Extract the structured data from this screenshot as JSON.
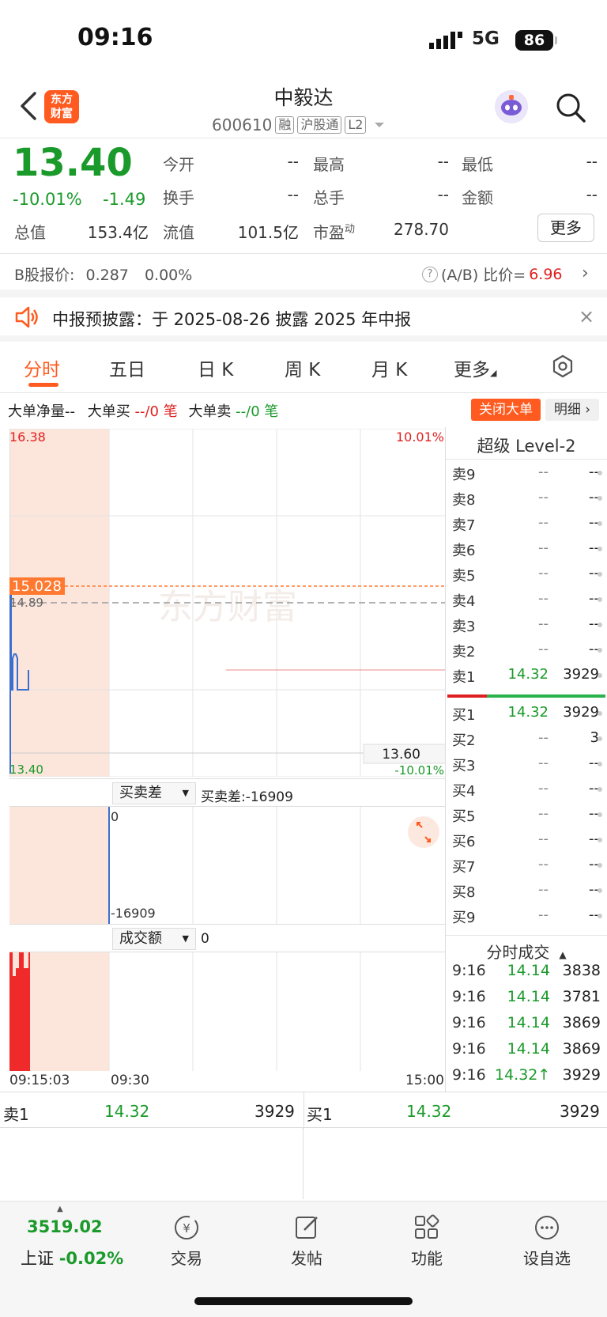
{
  "status": {
    "time": "09:16",
    "network": "5G",
    "battery": "86"
  },
  "header": {
    "logo": [
      "东方",
      "财富"
    ],
    "stock_name": "中毅达",
    "stock_code": "600610",
    "tags": [
      "融",
      "沪股通",
      "L2"
    ]
  },
  "quote": {
    "price": "13.40",
    "pct": "-10.01%",
    "change": "-1.49",
    "fields": [
      {
        "label": "今开",
        "value": "--"
      },
      {
        "label": "最高",
        "value": "--"
      },
      {
        "label": "最低",
        "value": "--"
      },
      {
        "label": "换手",
        "value": "--"
      },
      {
        "label": "总手",
        "value": "--"
      },
      {
        "label": "金额",
        "value": "--"
      }
    ],
    "total_cap_label": "总值",
    "total_cap": "153.4亿",
    "float_cap_label": "流值",
    "float_cap": "101.5亿",
    "pe_label": "市盈",
    "pe_sup": "动",
    "pe": "278.70",
    "more": "更多"
  },
  "bshare": {
    "label": "B股报价:",
    "price": "0.287",
    "pct": "0.00%",
    "ratio_label": "(A/B) 比价=",
    "ratio": "6.96",
    "help": "?"
  },
  "notice": {
    "text": "中报预披露：于 2025-08-26 披露 2025 年中报",
    "close": "×"
  },
  "tabs": [
    "分时",
    "五日",
    "日 K",
    "周 K",
    "月 K",
    "更多"
  ],
  "bigorder": {
    "net": "大单净量--",
    "buy": "大单买",
    "buy_val": "--/0 笔",
    "sell": "大单卖",
    "sell_val": "--/0 笔",
    "close_btn": "关闭大单",
    "detail_btn": "明细"
  },
  "chart": {
    "top_price": "16.38",
    "top_pct": "10.01%",
    "avg_price": "15.028",
    "prev_close": "14.89",
    "cur_box_price": "13.60",
    "cur_box_pct": "-10.01%",
    "bottom_price": "13.40",
    "watermark": "东方财富",
    "diff_selector": "买卖差",
    "diff_value": "买卖差:-16909",
    "diff_top": "0",
    "diff_bottom": "-16909",
    "amt_selector": "成交额",
    "amt_value": "0",
    "time_start": "09:15:03",
    "time_mid": "09:30",
    "time_end": "15:00"
  },
  "orderbook": {
    "title": "超级 Level-2",
    "sells": [
      {
        "label": "卖9",
        "price": "--",
        "vol": "--"
      },
      {
        "label": "卖8",
        "price": "--",
        "vol": "--"
      },
      {
        "label": "卖7",
        "price": "--",
        "vol": "--"
      },
      {
        "label": "卖6",
        "price": "--",
        "vol": "--"
      },
      {
        "label": "卖5",
        "price": "--",
        "vol": "--"
      },
      {
        "label": "卖4",
        "price": "--",
        "vol": "--"
      },
      {
        "label": "卖3",
        "price": "--",
        "vol": "--"
      },
      {
        "label": "卖2",
        "price": "--",
        "vol": "--"
      },
      {
        "label": "卖1",
        "price": "14.32",
        "vol": "3929"
      }
    ],
    "buys": [
      {
        "label": "买1",
        "price": "14.32",
        "vol": "3929"
      },
      {
        "label": "买2",
        "price": "--",
        "vol": "3"
      },
      {
        "label": "买3",
        "price": "--",
        "vol": "--"
      },
      {
        "label": "买4",
        "price": "--",
        "vol": "--"
      },
      {
        "label": "买5",
        "price": "--",
        "vol": "--"
      },
      {
        "label": "买6",
        "price": "--",
        "vol": "--"
      },
      {
        "label": "买7",
        "price": "--",
        "vol": "--"
      },
      {
        "label": "买8",
        "price": "--",
        "vol": "--"
      },
      {
        "label": "买9",
        "price": "--",
        "vol": "--"
      }
    ],
    "trades_title": "分时成交",
    "trades": [
      {
        "time": "9:16",
        "price": "14.14",
        "vol": "3838"
      },
      {
        "time": "9:16",
        "price": "14.14",
        "vol": "3781"
      },
      {
        "time": "9:16",
        "price": "14.14",
        "vol": "3869"
      },
      {
        "time": "9:16",
        "price": "14.14",
        "vol": "3869"
      },
      {
        "time": "9:16",
        "price": "14.32↑",
        "vol": "3929"
      }
    ]
  },
  "bottom_quote": {
    "sell_label": "卖1",
    "sell_price": "14.32",
    "sell_vol": "3929",
    "buy_label": "买1",
    "buy_price": "14.32",
    "buy_vol": "3929"
  },
  "tabbar": {
    "index_value": "3519.02",
    "index_name": "上证",
    "index_pct": "-0.02%",
    "items": [
      "交易",
      "发帖",
      "功能",
      "设自选"
    ]
  }
}
